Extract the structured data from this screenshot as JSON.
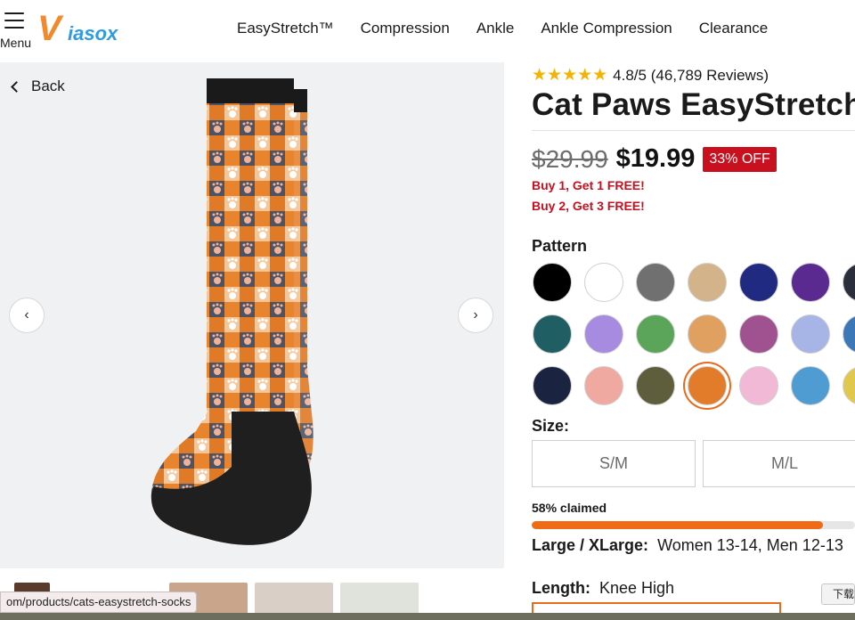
{
  "header": {
    "menu_label": "Menu",
    "logo": {
      "first": "V",
      "rest": "iasox"
    },
    "nav": [
      "EasyStretch™",
      "Compression",
      "Ankle",
      "Ankle Compression",
      "Clearance"
    ]
  },
  "gallery": {
    "back_label": "Back",
    "prev_icon": "chevron-left-icon",
    "next_icon": "chevron-right-icon"
  },
  "product": {
    "rating_stars": "★★★★★",
    "rating_text": "4.8/5 (46,789 Reviews)",
    "title": "Cat Paws EasyStretch™",
    "old_price": "$29.99",
    "new_price": "$19.99",
    "discount": "33% OFF",
    "promos": [
      "Buy 1, Get 1 FREE!",
      "Buy 2, Get 3 FREE!"
    ],
    "pattern_label": "Pattern",
    "swatches": [
      {
        "name": "black",
        "color": "#000000"
      },
      {
        "name": "white",
        "color": "#ffffff"
      },
      {
        "name": "gray",
        "color": "#707070"
      },
      {
        "name": "tan",
        "color": "#d3b48a"
      },
      {
        "name": "navy",
        "color": "#1f2a80"
      },
      {
        "name": "purple",
        "color": "#5a2a90"
      },
      {
        "name": "dark-pattern",
        "color": "#2b2f3c"
      },
      {
        "name": "teal-pattern",
        "color": "#1f5f63"
      },
      {
        "name": "purple-floral",
        "color": "#a68be0"
      },
      {
        "name": "colorful-blocks",
        "color": "#5aa55a"
      },
      {
        "name": "cat-faces",
        "color": "#e0a060"
      },
      {
        "name": "pink-floral",
        "color": "#a0518f"
      },
      {
        "name": "lavender-pattern",
        "color": "#a6b4e6"
      },
      {
        "name": "blue-yellow",
        "color": "#3c77b8"
      },
      {
        "name": "space",
        "color": "#1a2440"
      },
      {
        "name": "pink-cats",
        "color": "#f0a9a0"
      },
      {
        "name": "camo",
        "color": "#5e5e3c"
      },
      {
        "name": "cat-paws",
        "color": "#e27b2a"
      },
      {
        "name": "pastel-pattern",
        "color": "#f2b9d6"
      },
      {
        "name": "blue-cats",
        "color": "#4e9cd2"
      },
      {
        "name": "yellow-pattern",
        "color": "#e0c84e"
      }
    ],
    "selected_swatch": 17,
    "size_label": "Size:",
    "sizes": [
      "S/M",
      "M/L"
    ],
    "claimed_text": "58% claimed",
    "claimed_fraction": 0.9,
    "size_detail": {
      "name": "Large / XLarge:",
      "value": "Women 13-14, Men 12-13"
    },
    "length": {
      "label": "Length:",
      "value": "Knee High"
    }
  },
  "browser": {
    "status_url": "om/products/cats-easystretch-socks",
    "translate_chip": "下载"
  }
}
